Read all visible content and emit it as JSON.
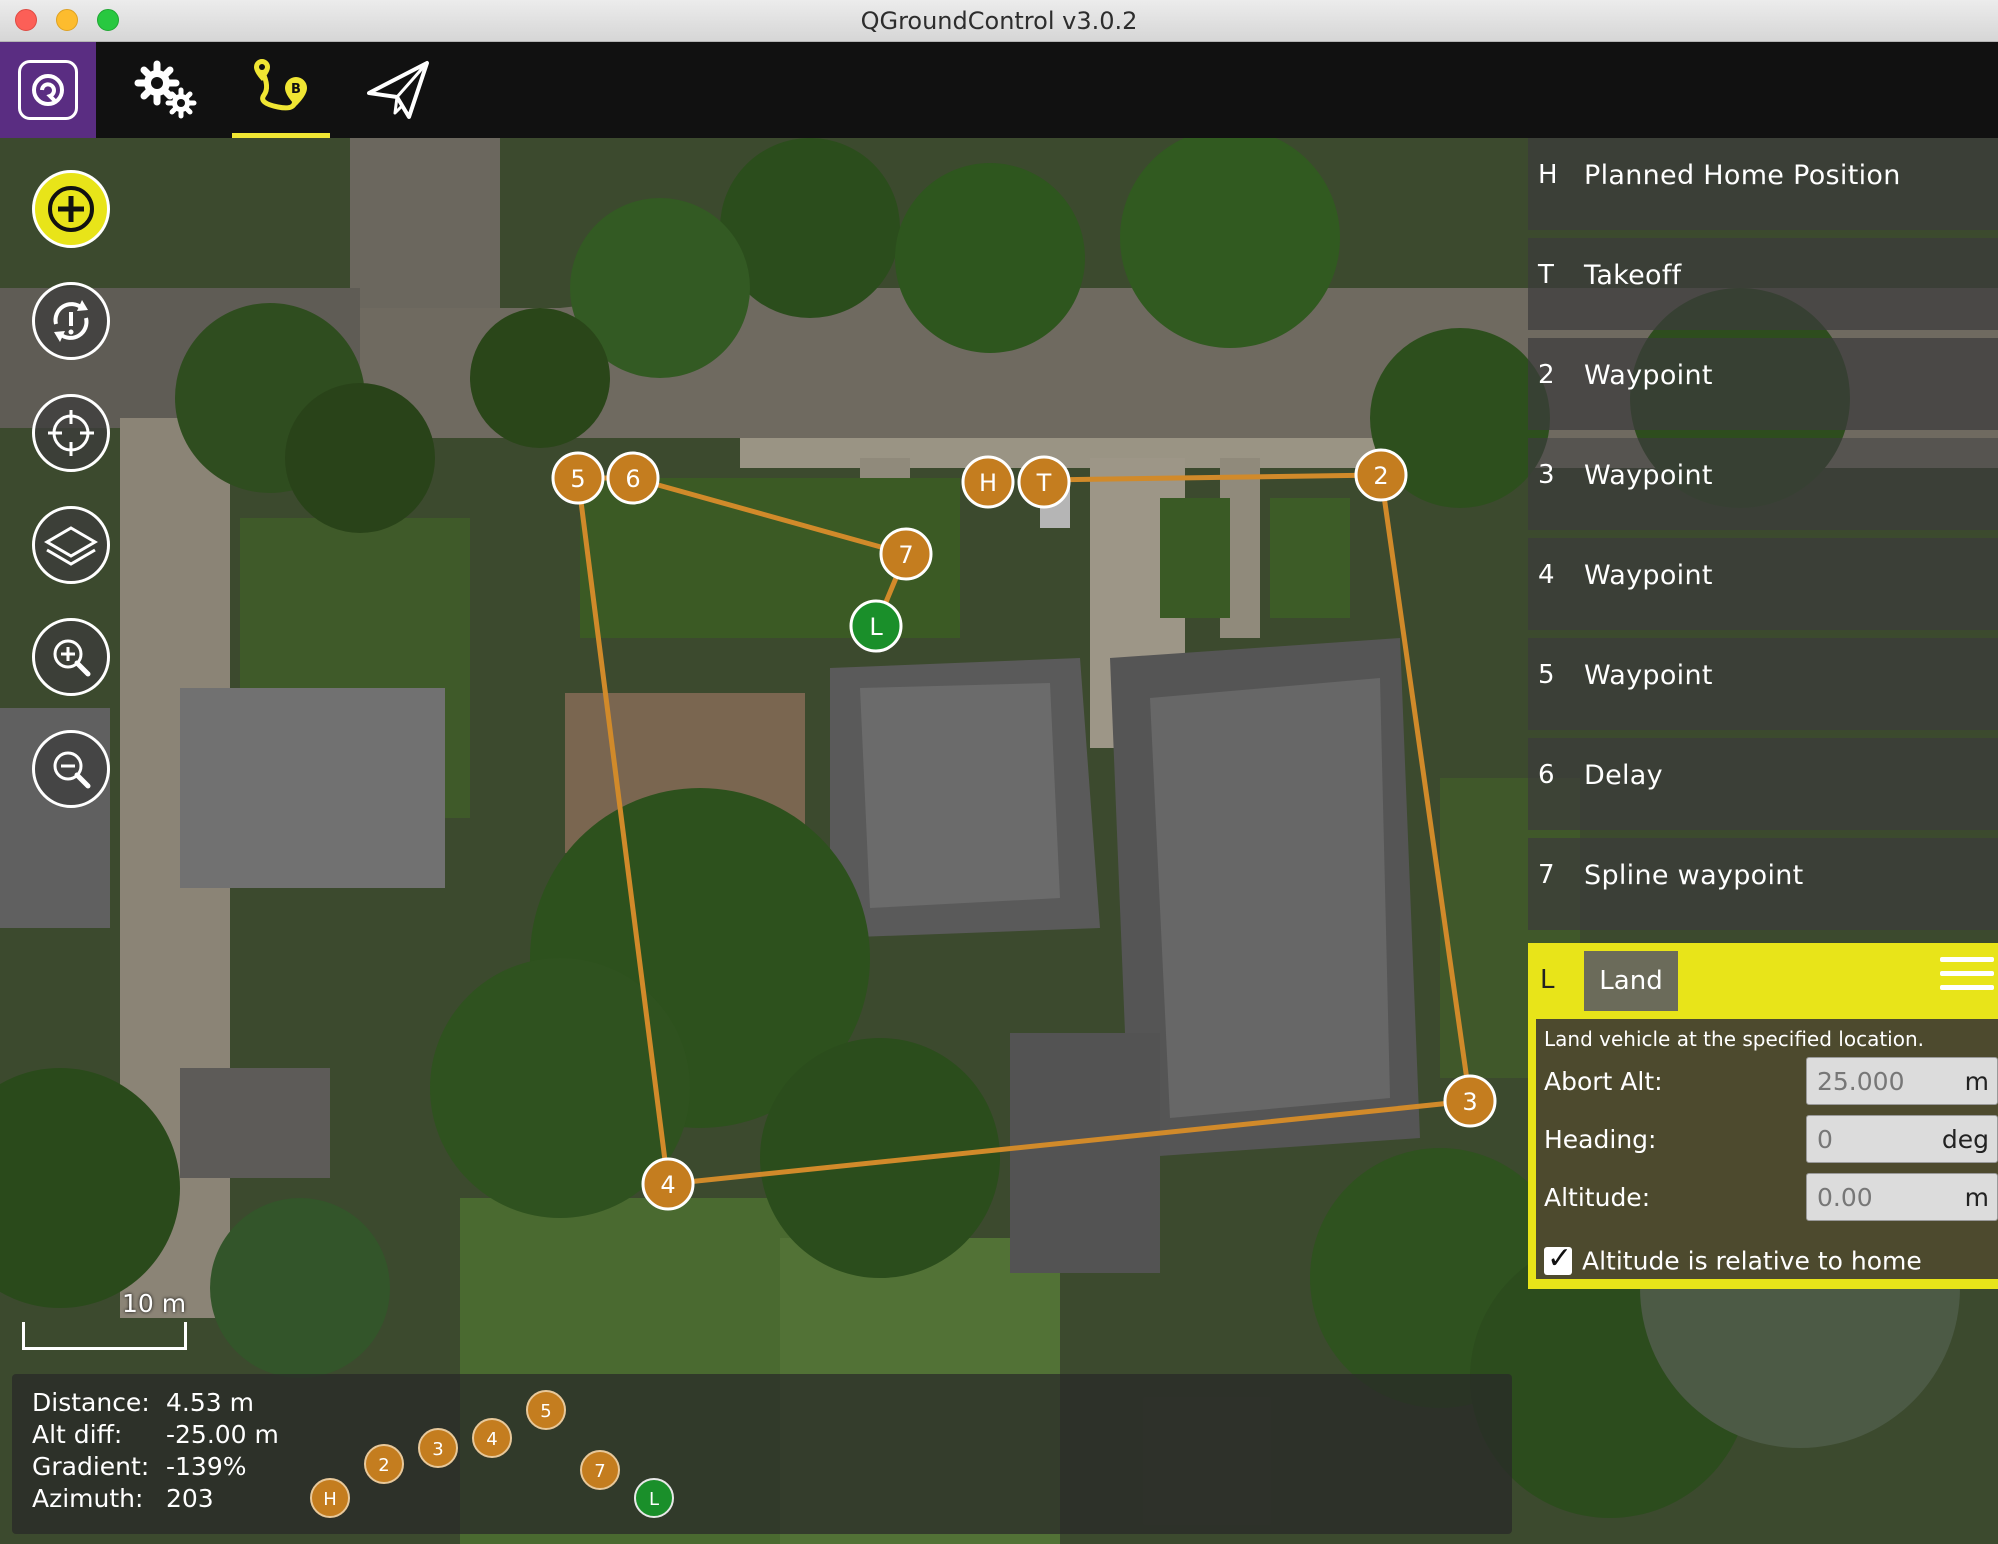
{
  "window": {
    "title": "QGroundControl v3.0.2"
  },
  "toolbar": {
    "icons": [
      "qgc-logo-icon",
      "gear-icon",
      "plan-route-icon",
      "fly-paper-plane-icon"
    ],
    "active": "plan",
    "accent": "#f0e633"
  },
  "map_tools": [
    "add-waypoint-icon",
    "sync-icon",
    "center-target-icon",
    "layers-icon",
    "zoom-in-icon",
    "zoom-out-icon"
  ],
  "scale": {
    "label": "10 m"
  },
  "markers": {
    "home": "H",
    "takeoff": "T",
    "wp2": "2",
    "wp3": "3",
    "wp4": "4",
    "wp5": "5",
    "wp6": "6",
    "wp7": "7",
    "land": "L",
    "colors": {
      "waypoint": "#c47d1f",
      "land": "#1a8f2a",
      "path": "#d18a2a"
    }
  },
  "mission_list": {
    "items": [
      {
        "seq": "H",
        "name": "Planned Home Position"
      },
      {
        "seq": "T",
        "name": "Takeoff"
      },
      {
        "seq": "2",
        "name": "Waypoint"
      },
      {
        "seq": "3",
        "name": "Waypoint"
      },
      {
        "seq": "4",
        "name": "Waypoint"
      },
      {
        "seq": "5",
        "name": "Waypoint"
      },
      {
        "seq": "6",
        "name": "Delay"
      },
      {
        "seq": "7",
        "name": "Spline waypoint"
      }
    ],
    "selected": {
      "seq": "L",
      "command": "Land",
      "description": "Land vehicle at the specified location.",
      "fields": [
        {
          "label": "Abort Alt:",
          "value": "25.000",
          "unit": "m"
        },
        {
          "label": "Heading:",
          "value": "0",
          "unit": "deg"
        },
        {
          "label": "Altitude:",
          "value": "0.00",
          "unit": "m"
        }
      ],
      "checkbox": {
        "label": "Altitude is relative to home",
        "checked": true
      }
    }
  },
  "status": {
    "distance": {
      "label": "Distance:",
      "value": "4.53 m"
    },
    "alt_diff": {
      "label": "Alt diff:",
      "value": "-25.00 m"
    },
    "gradient": {
      "label": "Gradient:",
      "value": "-139%"
    },
    "azimuth": {
      "label": "Azimuth:",
      "value": "203"
    },
    "profile_markers": [
      "H",
      "2",
      "3",
      "4",
      "5",
      "7",
      "L"
    ]
  }
}
